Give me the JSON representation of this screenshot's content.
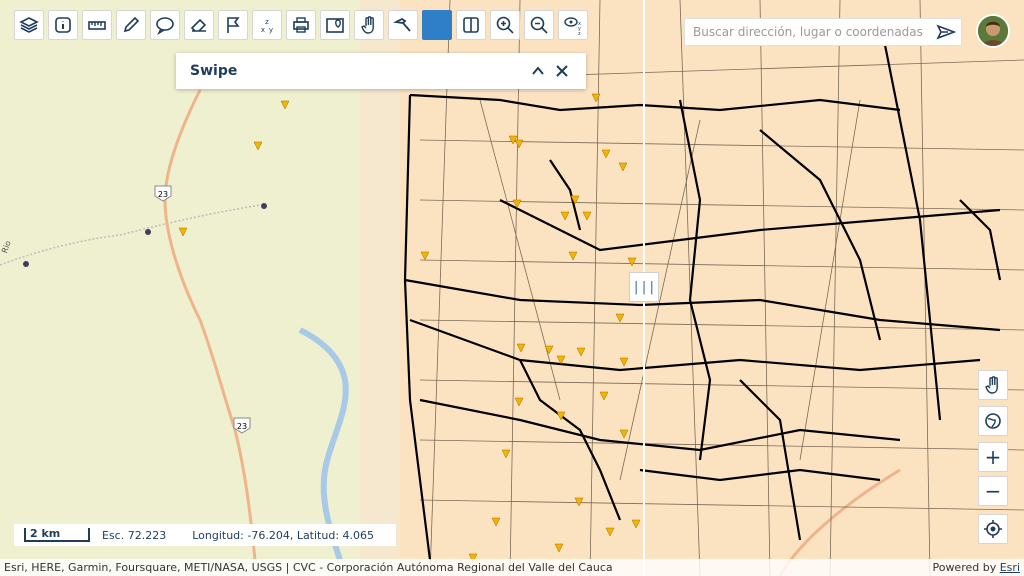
{
  "toolbar": {
    "tools": [
      {
        "name": "layers-tool",
        "icon": "layers-icon"
      },
      {
        "name": "info-tool",
        "icon": "info-icon"
      },
      {
        "name": "measure-tool",
        "icon": "ruler-icon"
      },
      {
        "name": "draw-tool",
        "icon": "pencil-icon"
      },
      {
        "name": "comment-tool",
        "icon": "speech-bubble-icon"
      },
      {
        "name": "erase-tool",
        "icon": "eraser-icon"
      },
      {
        "name": "marker-tool",
        "icon": "flag-icon"
      },
      {
        "name": "coordinate-tool",
        "icon": "xyz-icon"
      },
      {
        "name": "print-tool",
        "icon": "printer-icon"
      },
      {
        "name": "directions-tool",
        "icon": "map-pin-icon"
      },
      {
        "name": "pan-tool",
        "icon": "hand-icon"
      },
      {
        "name": "identify-tool",
        "icon": "hammer-icon"
      },
      {
        "name": "color-tool",
        "icon": "blue-square-icon"
      },
      {
        "name": "swipe-tool",
        "icon": "split-panel-icon"
      },
      {
        "name": "zoom-in-tool",
        "icon": "zoom-in-icon"
      },
      {
        "name": "zoom-out-tool",
        "icon": "zoom-out-icon"
      },
      {
        "name": "xy-tool",
        "icon": "eye-xyz-icon"
      }
    ]
  },
  "search": {
    "placeholder": "Buscar dirección, lugar o coordenadas"
  },
  "panel": {
    "title": "Swipe"
  },
  "swipe": {
    "handle": "|||"
  },
  "map_controls": {
    "zoom_in": "+",
    "zoom_out": "−"
  },
  "scalebar": {
    "distance": "2 km",
    "scale": "Esc. 72.223",
    "coordinates": "Longitud: -76.204, Latitud: 4.065"
  },
  "road_labels": [
    "23",
    "23",
    "Rio"
  ],
  "attribution": {
    "sources": "Esri, HERE, Garmin, Foursquare, METI/NASA, USGS | CVC - Corporación Autónoma Regional del Valle del Cauca",
    "powered": "Powered by ",
    "brand": "Esri"
  },
  "colors": {
    "accent": "#2e7fc7",
    "base": "#f5ecd6",
    "left_map": "#eef0cf",
    "parcel": "#fbe3c2",
    "marker": "#f5b400",
    "river": "#a9c9e8"
  }
}
